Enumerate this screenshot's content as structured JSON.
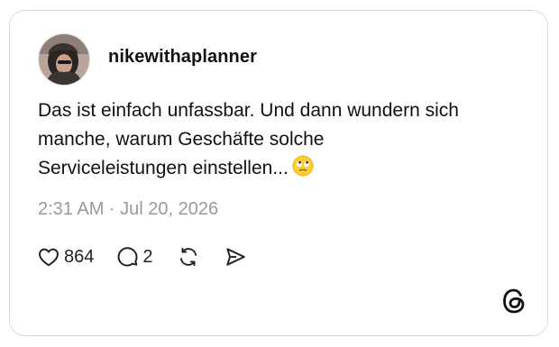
{
  "author": {
    "username": "nikewithaplanner",
    "avatar_icon": "profile-photo"
  },
  "post": {
    "text_lines": [
      "Das ist einfach unfassbar. Und dann wundern sich",
      "manche, warum Geschäfte solche",
      "Serviceleistungen einstellen..."
    ],
    "emoji": "face-with-rolling-eyes",
    "timestamp": "2:31 AM · Jul 20, 2026"
  },
  "actions": {
    "like": {
      "icon": "heart-icon",
      "count": "864"
    },
    "reply": {
      "icon": "comment-icon",
      "count": "2"
    },
    "repost": {
      "icon": "repost-icon"
    },
    "share": {
      "icon": "send-icon"
    }
  },
  "brand": {
    "logo_icon": "threads-logo",
    "text_color": "#111111",
    "muted_color": "#999999",
    "border_color": "#d9d9d9"
  }
}
